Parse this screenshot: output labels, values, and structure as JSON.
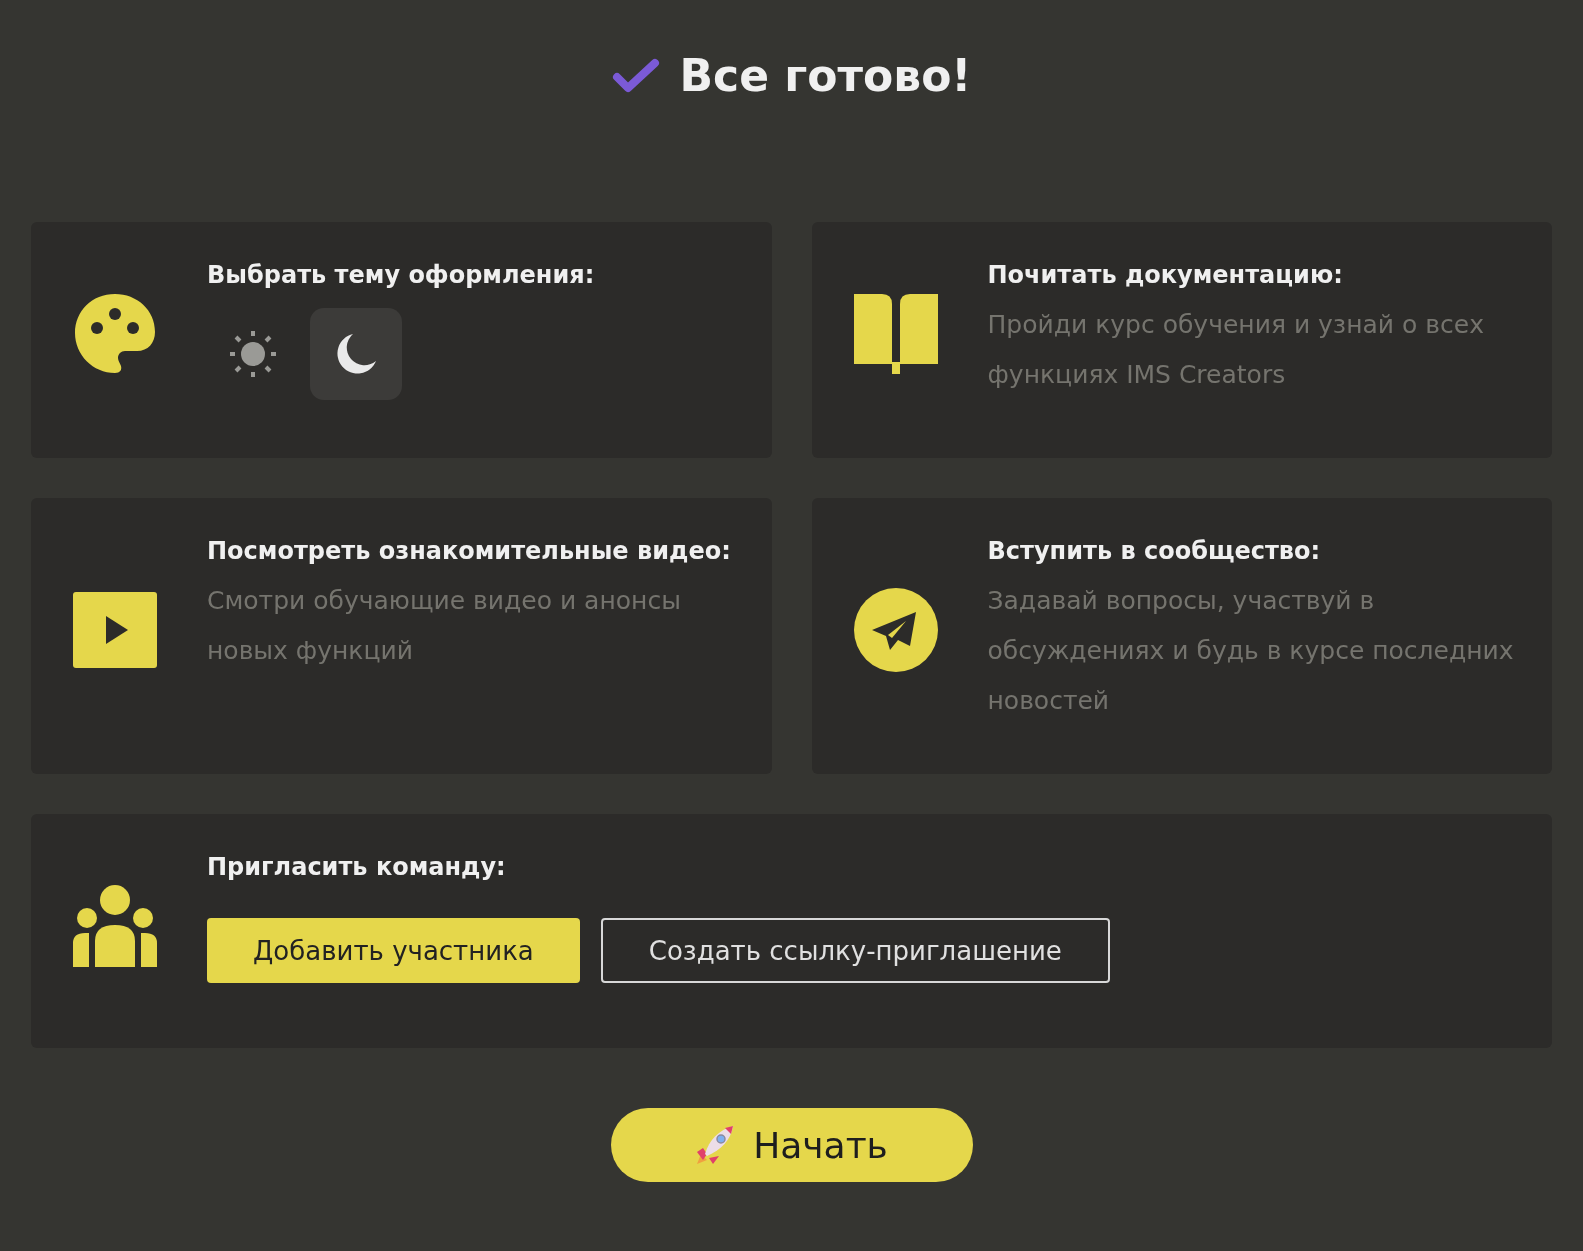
{
  "title": "Все готово!",
  "cards": [
    {
      "kind": "theme",
      "heading": "Выбрать тему оформления:",
      "options": [
        {
          "kind": "light",
          "selected": false
        },
        {
          "kind": "dark",
          "selected": true
        }
      ]
    },
    {
      "kind": "docs",
      "heading": "Почитать документацию:",
      "text": "Пройди курс обучения и узнай о всех функциях IMS Creators"
    },
    {
      "kind": "video",
      "heading": "Посмотреть ознакомительные видео:",
      "text": "Смотри обучающие видео и анонсы новых функций"
    },
    {
      "kind": "community",
      "heading": "Вступить в сообщество:",
      "text": "Задавай вопросы, участвуй в обсуждениях и будь в курсе последних новостей"
    },
    {
      "kind": "invite",
      "heading": "Пригласить команду:",
      "buttons": [
        {
          "kind": "primary",
          "label": "Добавить участника"
        },
        {
          "kind": "outline",
          "label": "Создать ссылку-приглашение"
        }
      ]
    }
  ],
  "start_button": {
    "label": "Начать"
  }
}
